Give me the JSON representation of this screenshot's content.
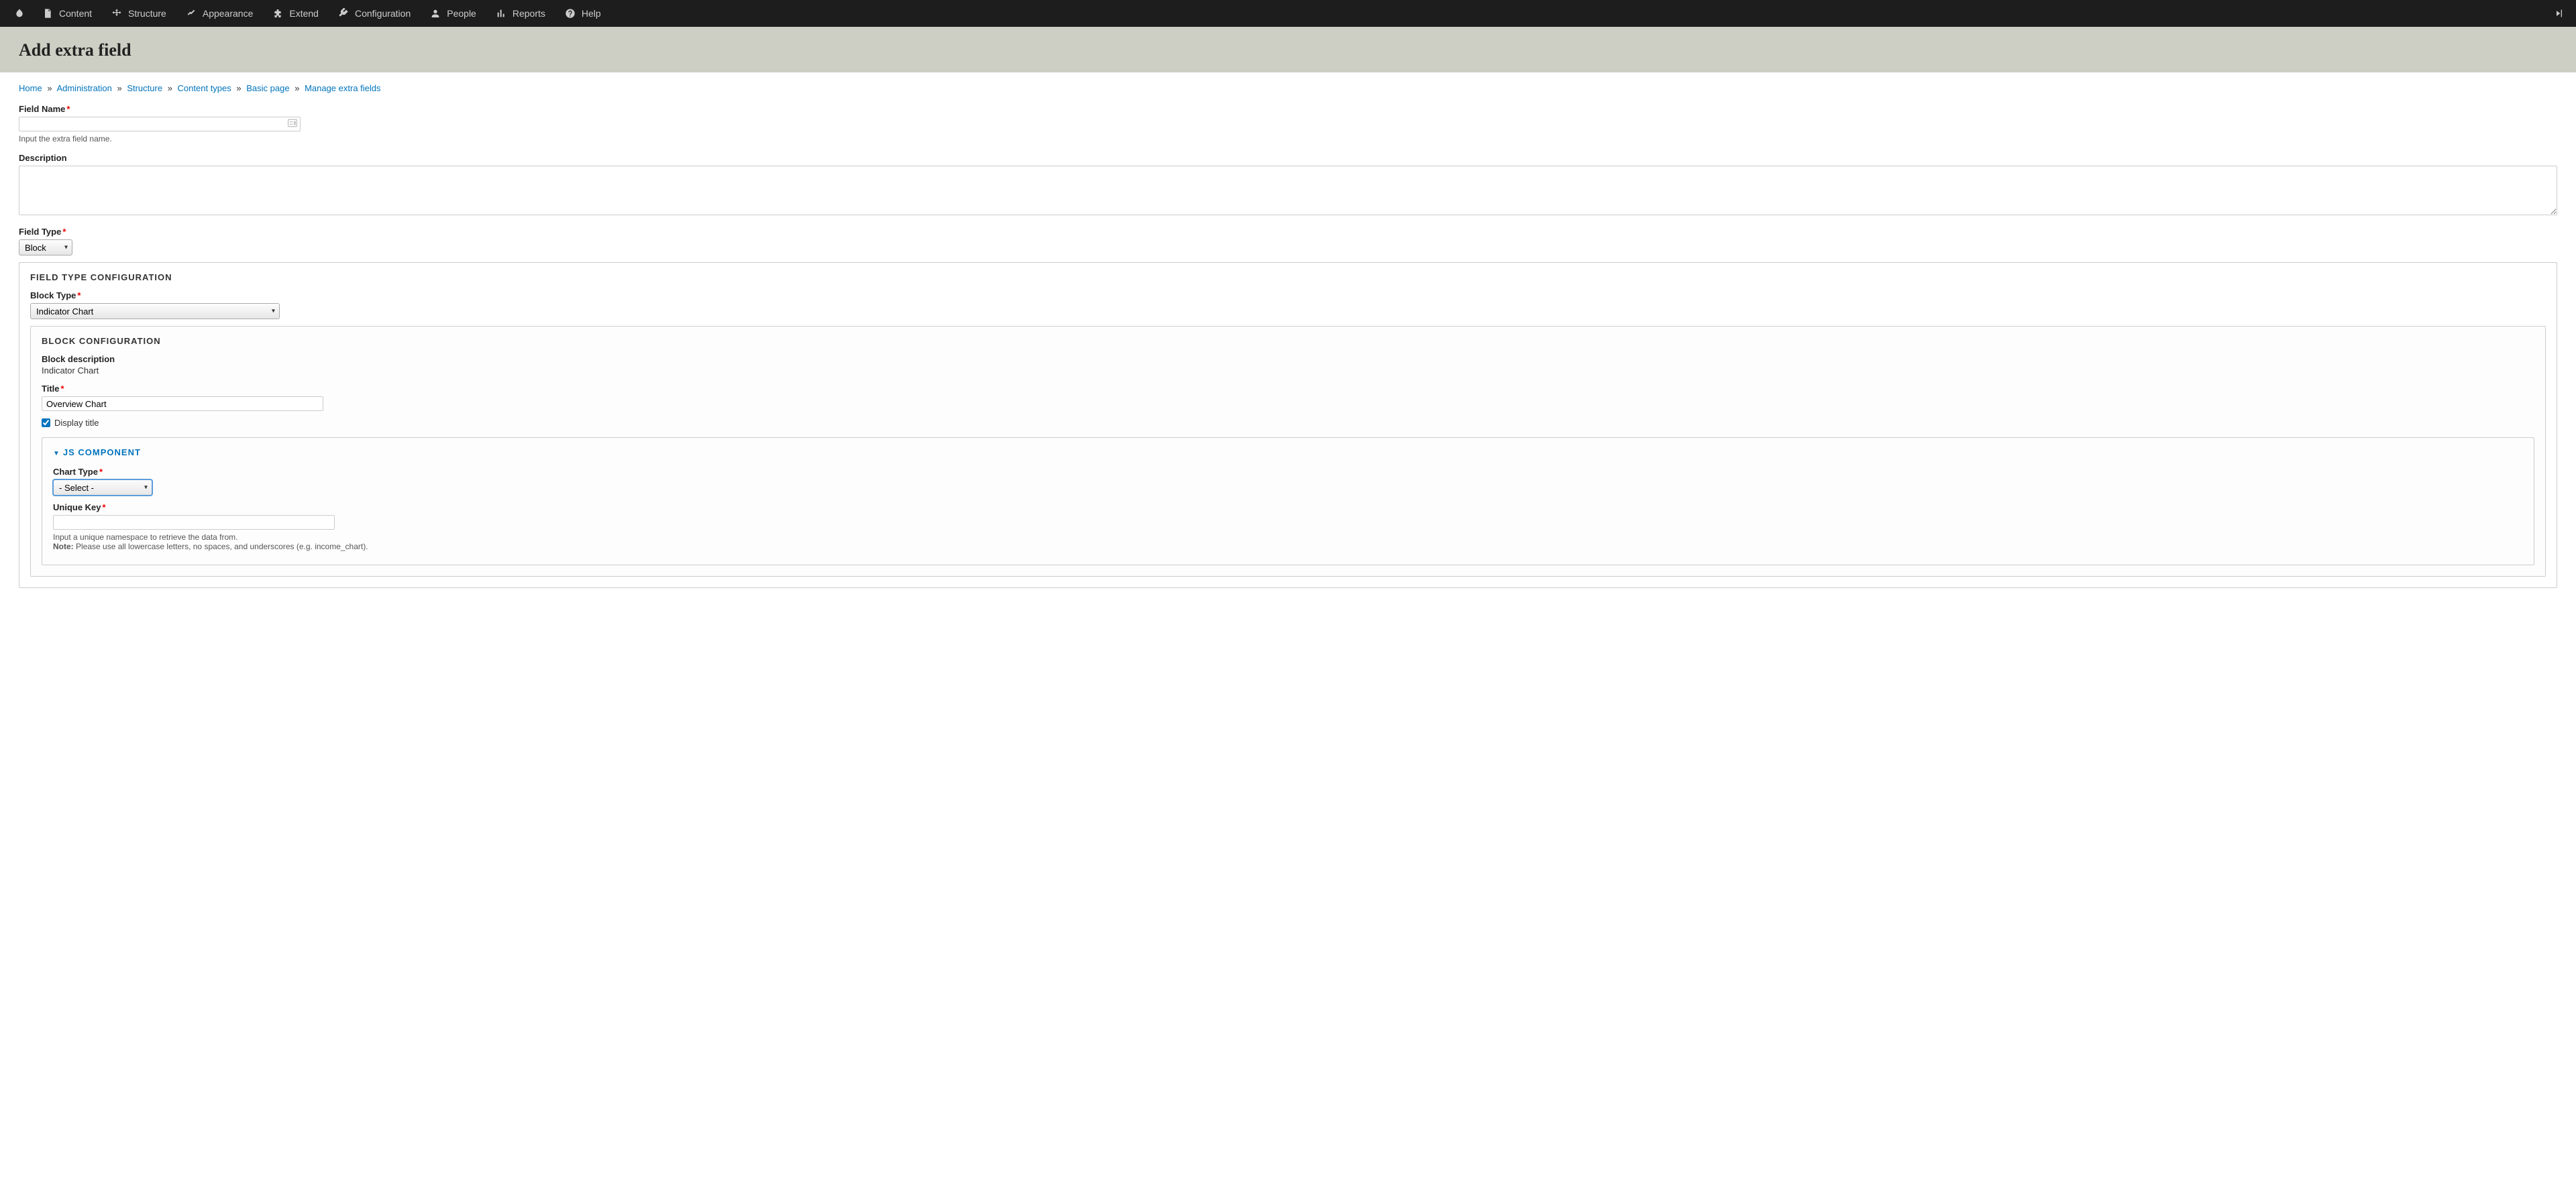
{
  "toolbar": {
    "items": [
      {
        "icon": "content",
        "label": "Content"
      },
      {
        "icon": "structure",
        "label": "Structure"
      },
      {
        "icon": "appearance",
        "label": "Appearance"
      },
      {
        "icon": "extend",
        "label": "Extend"
      },
      {
        "icon": "config",
        "label": "Configuration"
      },
      {
        "icon": "people",
        "label": "People"
      },
      {
        "icon": "reports",
        "label": "Reports"
      },
      {
        "icon": "help",
        "label": "Help"
      }
    ]
  },
  "page": {
    "title": "Add extra field"
  },
  "breadcrumb": {
    "items": [
      "Home",
      "Administration",
      "Structure",
      "Content types",
      "Basic page",
      "Manage extra fields"
    ],
    "separator": "»"
  },
  "form": {
    "field_name": {
      "label": "Field Name",
      "value": "",
      "description": "Input the extra field name."
    },
    "description": {
      "label": "Description",
      "value": ""
    },
    "field_type": {
      "label": "Field Type",
      "value": "Block"
    },
    "field_type_config": {
      "legend": "FIELD TYPE CONFIGURATION",
      "block_type": {
        "label": "Block Type",
        "value": "Indicator Chart"
      },
      "block_config": {
        "legend": "BLOCK CONFIGURATION",
        "block_desc_label": "Block description",
        "block_desc_value": "Indicator Chart",
        "title": {
          "label": "Title",
          "value": "Overview Chart"
        },
        "display_title": {
          "label": "Display title",
          "checked": true
        },
        "js_component": {
          "legend": "JS COMPONENT",
          "chart_type": {
            "label": "Chart Type",
            "value": "- Select -"
          },
          "unique_key": {
            "label": "Unique Key",
            "value": "",
            "description": "Input a unique namespace to retrieve the data from.",
            "note_bold": "Note:",
            "note_text": " Please use all lowercase letters, no spaces, and underscores (e.g. income_chart)."
          }
        }
      }
    }
  }
}
